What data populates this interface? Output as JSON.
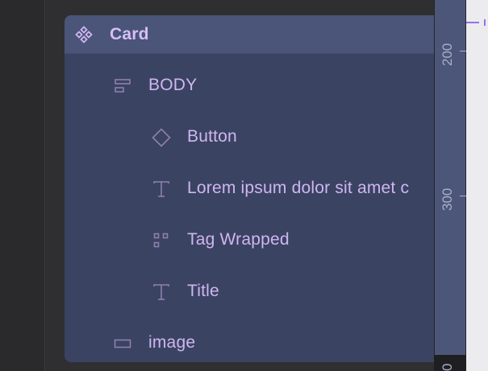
{
  "layers": {
    "component": {
      "label": "Card",
      "icon": "component-icon"
    },
    "items": [
      {
        "label": "BODY",
        "icon": "flex-layout-icon"
      },
      {
        "label": "Button",
        "icon": "component-instance-icon"
      },
      {
        "label": "Lorem ipsum dolor sit amet c",
        "icon": "text-icon"
      },
      {
        "label": "Tag Wrapped",
        "icon": "grid-layout-icon"
      },
      {
        "label": "Title",
        "icon": "text-icon"
      },
      {
        "label": "image",
        "icon": "rectangle-icon"
      }
    ]
  },
  "ruler": {
    "marks": [
      "200",
      "300",
      "0"
    ]
  },
  "colors": {
    "accent": "#cfb6f2",
    "panel": "#3b4362",
    "header": "#4a5579",
    "icon": "#8f7fb0"
  }
}
